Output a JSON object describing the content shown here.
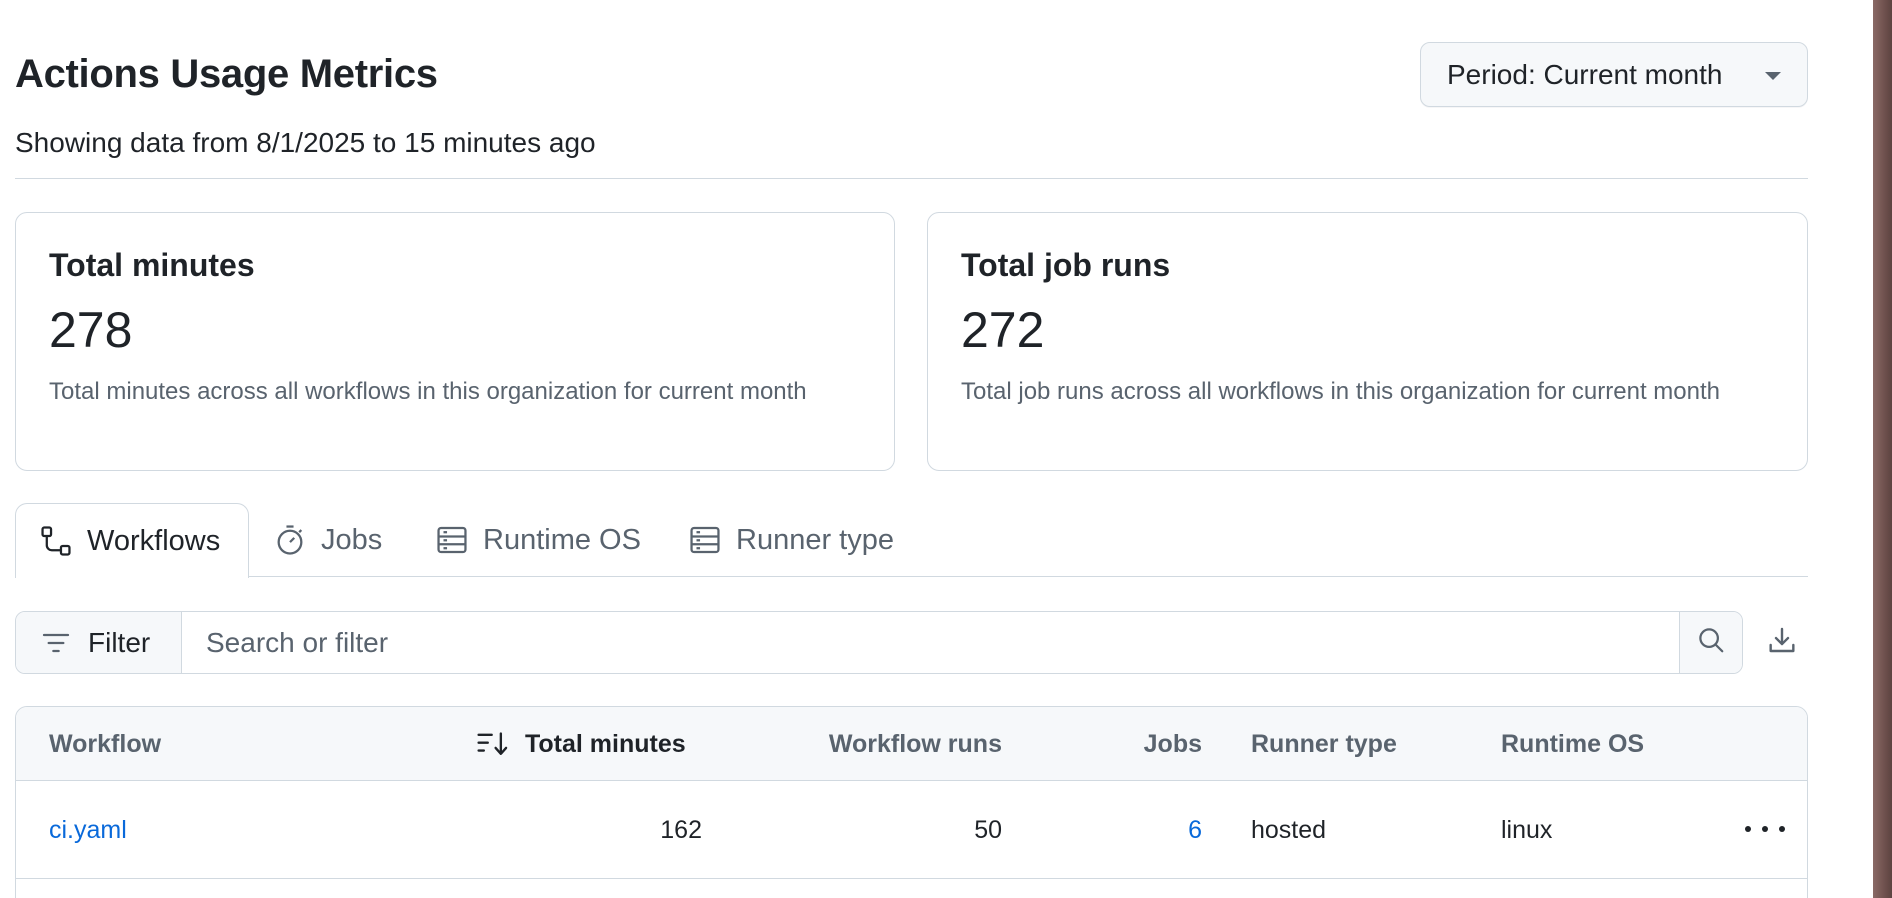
{
  "header": {
    "title": "Actions Usage Metrics",
    "subtitle": "Showing data from 8/1/2025 to 15 minutes ago",
    "period_label": "Period: Current month"
  },
  "cards": [
    {
      "title": "Total minutes",
      "value": "278",
      "description": "Total minutes across all workflows in this organization for current month"
    },
    {
      "title": "Total job runs",
      "value": "272",
      "description": "Total job runs across all workflows in this organization for current month"
    }
  ],
  "tabs": [
    {
      "label": "Workflows",
      "icon": "workflow-icon",
      "selected": true
    },
    {
      "label": "Jobs",
      "icon": "stopwatch-icon",
      "selected": false
    },
    {
      "label": "Runtime OS",
      "icon": "server-icon",
      "selected": false
    },
    {
      "label": "Runner type",
      "icon": "server-icon",
      "selected": false
    }
  ],
  "filter": {
    "button_label": "Filter",
    "search_placeholder": "Search or filter",
    "search_value": ""
  },
  "table": {
    "columns": [
      "Workflow",
      "Total minutes",
      "Workflow runs",
      "Jobs",
      "Runner type",
      "Runtime OS"
    ],
    "sorted_column": "Total minutes",
    "rows": [
      {
        "workflow": "ci.yaml",
        "total_minutes": "162",
        "workflow_runs": "50",
        "jobs": "6",
        "runner_type": "hosted",
        "runtime_os": "linux"
      }
    ]
  },
  "colors": {
    "link": "#0969da",
    "border": "#d1d9e0",
    "muted_text": "#59636e",
    "text": "#1f2328",
    "subtle_bg": "#f6f8fa"
  }
}
